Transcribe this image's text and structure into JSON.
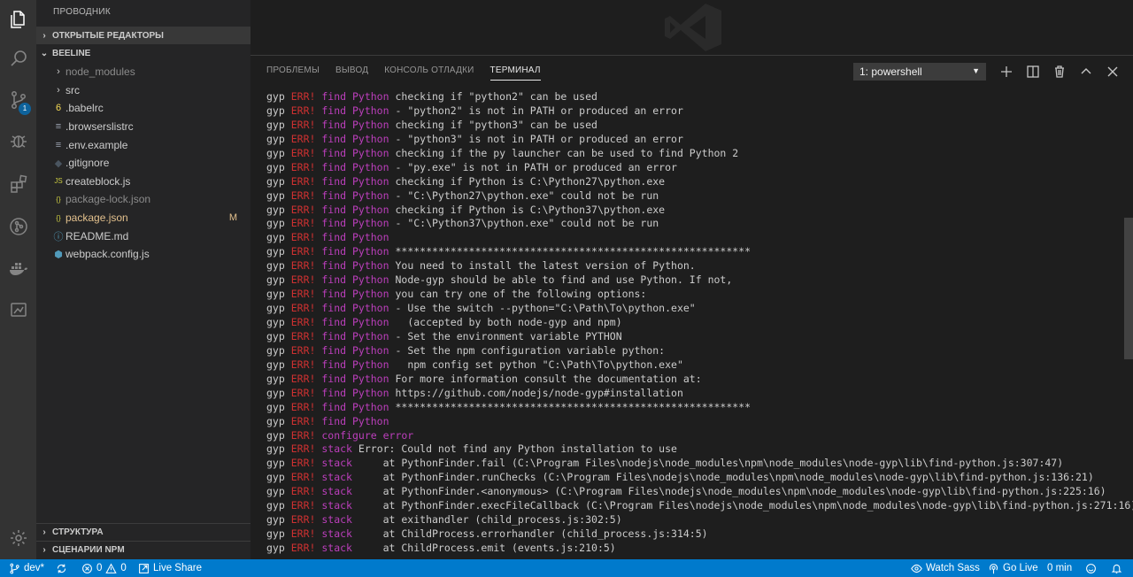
{
  "explorer": {
    "title": "ПРОВОДНИК",
    "open_editors": "ОТКРЫТЫЕ РЕДАКТОРЫ",
    "project": "BEELINE",
    "outline": "СТРУКТУРА",
    "npm_scripts": "СЦЕНАРИИ NPM",
    "modified_marker": "M",
    "files": [
      {
        "name": "node_modules",
        "kind": "folder",
        "style": "dim"
      },
      {
        "name": "src",
        "kind": "folder",
        "style": "normal"
      },
      {
        "name": ".babelrc",
        "kind": "babel",
        "style": "normal"
      },
      {
        "name": ".browserslistrc",
        "kind": "text",
        "style": "normal"
      },
      {
        "name": ".env.example",
        "kind": "text",
        "style": "normal"
      },
      {
        "name": ".gitignore",
        "kind": "git",
        "style": "normal"
      },
      {
        "name": "createblock.js",
        "kind": "js",
        "style": "normal"
      },
      {
        "name": "package-lock.json",
        "kind": "json",
        "style": "dim"
      },
      {
        "name": "package.json",
        "kind": "json",
        "style": "modified"
      },
      {
        "name": "README.md",
        "kind": "info",
        "style": "normal"
      },
      {
        "name": "webpack.config.js",
        "kind": "webpack",
        "style": "normal"
      }
    ]
  },
  "activity": {
    "scm_badge": "1"
  },
  "panel": {
    "tabs": [
      "ПРОБЛЕМЫ",
      "ВЫВОД",
      "КОНСОЛЬ ОТЛАДКИ",
      "ТЕРМИНАЛ"
    ],
    "active_tab": 3,
    "terminal_select": "1: powershell"
  },
  "terminal": {
    "lines": [
      [
        "gyp",
        "ERR!",
        "find Python",
        "checking if \"python2\" can be used"
      ],
      [
        "gyp",
        "ERR!",
        "find Python",
        "- \"python2\" is not in PATH or produced an error"
      ],
      [
        "gyp",
        "ERR!",
        "find Python",
        "checking if \"python3\" can be used"
      ],
      [
        "gyp",
        "ERR!",
        "find Python",
        "- \"python3\" is not in PATH or produced an error"
      ],
      [
        "gyp",
        "ERR!",
        "find Python",
        "checking if the py launcher can be used to find Python 2"
      ],
      [
        "gyp",
        "ERR!",
        "find Python",
        "- \"py.exe\" is not in PATH or produced an error"
      ],
      [
        "gyp",
        "ERR!",
        "find Python",
        "checking if Python is C:\\Python27\\python.exe"
      ],
      [
        "gyp",
        "ERR!",
        "find Python",
        "- \"C:\\Python27\\python.exe\" could not be run"
      ],
      [
        "gyp",
        "ERR!",
        "find Python",
        "checking if Python is C:\\Python37\\python.exe"
      ],
      [
        "gyp",
        "ERR!",
        "find Python",
        "- \"C:\\Python37\\python.exe\" could not be run"
      ],
      [
        "gyp",
        "ERR!",
        "find Python",
        ""
      ],
      [
        "gyp",
        "ERR!",
        "find Python",
        "**********************************************************"
      ],
      [
        "gyp",
        "ERR!",
        "find Python",
        "You need to install the latest version of Python."
      ],
      [
        "gyp",
        "ERR!",
        "find Python",
        "Node-gyp should be able to find and use Python. If not,"
      ],
      [
        "gyp",
        "ERR!",
        "find Python",
        "you can try one of the following options:"
      ],
      [
        "gyp",
        "ERR!",
        "find Python",
        "- Use the switch --python=\"C:\\Path\\To\\python.exe\""
      ],
      [
        "gyp",
        "ERR!",
        "find Python",
        "  (accepted by both node-gyp and npm)"
      ],
      [
        "gyp",
        "ERR!",
        "find Python",
        "- Set the environment variable PYTHON"
      ],
      [
        "gyp",
        "ERR!",
        "find Python",
        "- Set the npm configuration variable python:"
      ],
      [
        "gyp",
        "ERR!",
        "find Python",
        "  npm config set python \"C:\\Path\\To\\python.exe\""
      ],
      [
        "gyp",
        "ERR!",
        "find Python",
        "For more information consult the documentation at:"
      ],
      [
        "gyp",
        "ERR!",
        "find Python",
        "https://github.com/nodejs/node-gyp#installation"
      ],
      [
        "gyp",
        "ERR!",
        "find Python",
        "**********************************************************"
      ],
      [
        "gyp",
        "ERR!",
        "find Python",
        ""
      ],
      [
        "gyp",
        "ERR!",
        "configure error",
        ""
      ],
      [
        "gyp",
        "ERR!",
        "stack",
        "Error: Could not find any Python installation to use"
      ],
      [
        "gyp",
        "ERR!",
        "stack",
        "    at PythonFinder.fail (C:\\Program Files\\nodejs\\node_modules\\npm\\node_modules\\node-gyp\\lib\\find-python.js:307:47)"
      ],
      [
        "gyp",
        "ERR!",
        "stack",
        "    at PythonFinder.runChecks (C:\\Program Files\\nodejs\\node_modules\\npm\\node_modules\\node-gyp\\lib\\find-python.js:136:21)"
      ],
      [
        "gyp",
        "ERR!",
        "stack",
        "    at PythonFinder.<anonymous> (C:\\Program Files\\nodejs\\node_modules\\npm\\node_modules\\node-gyp\\lib\\find-python.js:225:16)"
      ],
      [
        "gyp",
        "ERR!",
        "stack",
        "    at PythonFinder.execFileCallback (C:\\Program Files\\nodejs\\node_modules\\npm\\node_modules\\node-gyp\\lib\\find-python.js:271:16)"
      ],
      [
        "gyp",
        "ERR!",
        "stack",
        "    at exithandler (child_process.js:302:5)"
      ],
      [
        "gyp",
        "ERR!",
        "stack",
        "    at ChildProcess.errorhandler (child_process.js:314:5)"
      ],
      [
        "gyp",
        "ERR!",
        "stack",
        "    at ChildProcess.emit (events.js:210:5)"
      ]
    ]
  },
  "status": {
    "branch": "dev*",
    "errors": "0",
    "warnings": "0",
    "live_share": "Live Share",
    "watch_sass": "Watch Sass",
    "go_live": "Go Live",
    "time": "0 min"
  },
  "colors": {
    "accent": "#007acc",
    "error": "#cd3131",
    "category": "#bc3fbc",
    "modified": "#e2c08d"
  }
}
